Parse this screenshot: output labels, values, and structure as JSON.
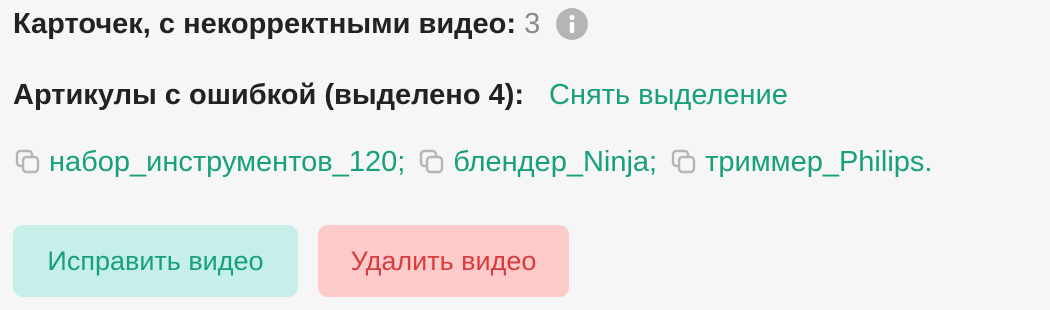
{
  "summary": {
    "label": "Карточек, с некорректными видео:",
    "count": "3",
    "info_icon": "info-icon"
  },
  "selection": {
    "label": "Артикулы с ошибкой (выделено 4):",
    "clear_link": "Снять выделение"
  },
  "articles": [
    {
      "icon": "copy-icon",
      "text": "набор_инструментов_120;"
    },
    {
      "icon": "copy-icon",
      "text": "блендер_Ninja;"
    },
    {
      "icon": "copy-icon",
      "text": "триммер_Philips."
    }
  ],
  "actions": {
    "fix_label": "Исправить видео",
    "delete_label": "Удалить видео"
  },
  "colors": {
    "background": "#f6f6f6",
    "accent_green": "#17a07c",
    "fix_button_bg": "#c6efe9",
    "delete_button_bg": "#fdcaca",
    "delete_text": "#d83c3c",
    "icon_gray": "#b5b5b5"
  }
}
